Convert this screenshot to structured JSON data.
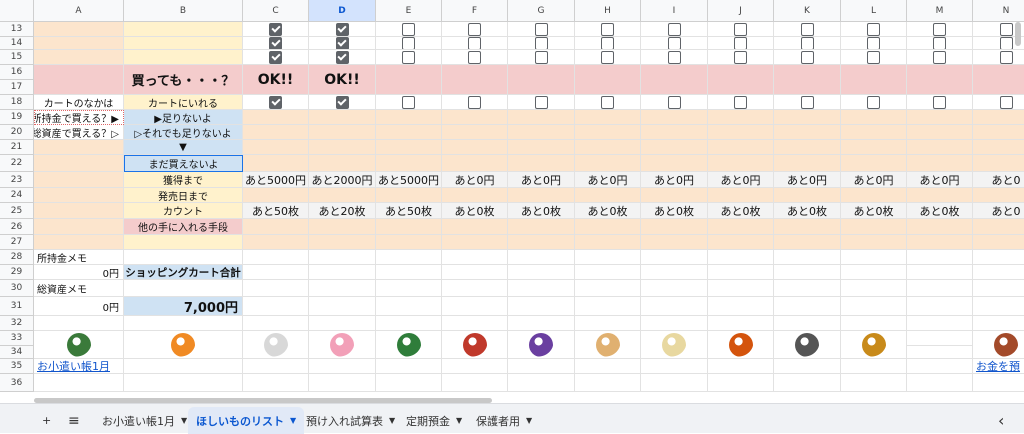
{
  "columns": [
    "A",
    "B",
    "C",
    "D",
    "E",
    "F",
    "G",
    "H",
    "I",
    "J",
    "K",
    "L",
    "M",
    "N"
  ],
  "selected_column": "D",
  "row_numbers": [
    "13",
    "14",
    "15",
    "16",
    "17",
    "18",
    "19",
    "20",
    "21",
    "22",
    "23",
    "24",
    "25",
    "26",
    "27",
    "28",
    "29",
    "30",
    "31",
    "32",
    "33",
    "34",
    "35",
    "36"
  ],
  "table": {
    "row16_title": "買っても・・・？",
    "ok_c": "OK!!",
    "ok_d": "OK!!",
    "cart_label": "カートのなかは",
    "cart_action": "カートにいれる",
    "funds_question": "所持金で買える？▶",
    "funds_answer": "▶足りないよ",
    "assets_question": "総資産で買える？▷",
    "assets_answer": "▷それでも足りないよ",
    "arrow": "▼",
    "still_cannot": "まだ買えないよ",
    "until_obtain": "獲得まで",
    "until_release": "発売日まで",
    "count": "カウント",
    "other_means": "他の手に入れる手段",
    "remaining_amounts": [
      "あと5000円",
      "あと2000円",
      "あと5000円",
      "あと0円",
      "あと0円",
      "あと0円",
      "あと0円",
      "あと0円",
      "あと0円",
      "あと0円",
      "あと0円",
      "あと0"
    ],
    "remaining_counts": [
      "あと50枚",
      "あと20枚",
      "あと50枚",
      "あと0枚",
      "あと0枚",
      "あと0枚",
      "あと0枚",
      "あと0枚",
      "あと0枚",
      "あと0枚",
      "あと0枚",
      "あと0"
    ],
    "checks_row13": [
      true,
      true,
      false,
      false,
      false,
      false,
      false,
      false,
      false,
      false,
      false,
      false
    ],
    "checks_row14": [
      true,
      true,
      false,
      false,
      false,
      false,
      false,
      false,
      false,
      false,
      false,
      false
    ],
    "checks_row15": [
      true,
      true,
      false,
      false,
      false,
      false,
      false,
      false,
      false,
      false,
      false,
      false
    ],
    "checks_row18": [
      true,
      true,
      false,
      false,
      false,
      false,
      false,
      false,
      false,
      false,
      false,
      false
    ]
  },
  "memo": {
    "funds_memo": "所持金メモ",
    "funds_value": "0円",
    "cart_total_label": "ショッピングカート合計",
    "assets_memo": "総資産メモ",
    "assets_value": "0円",
    "cart_total_value": "7,000円"
  },
  "links": {
    "allowance": "お小遣い帳1月",
    "money_cut": "お金を預"
  },
  "figures": {
    "icon_names": [
      "figure-usopp-icon",
      "figure-nami-icon",
      "figure-brook-icon",
      "figure-chopper-icon",
      "figure-zoro-icon",
      "figure-franky-icon",
      "figure-robin-icon",
      "figure-sanji-icon",
      "figure-law-icon",
      "figure-ace-icon",
      "figure-kid-icon",
      "figure-jinbe-icon",
      "figure-luffy-icon"
    ],
    "colors": [
      "#3a7a3a",
      "#f08a24",
      "#d8d8d8",
      "#f2a0b8",
      "#2f7d3a",
      "#c0392b",
      "#6a3fa0",
      "#e0b070",
      "#e8d8a0",
      "#d4540d",
      "#555555",
      "#c88a1a",
      "#a34a2a"
    ]
  },
  "sheet_tabs": {
    "add_icon": "+",
    "menu_icon": "≡",
    "tabs": [
      "お小遣い帳1月",
      "ほしいものリスト",
      "預け入れ試算表",
      "定期預金",
      "保護者用"
    ],
    "active_tab": "ほしいものリスト",
    "scroll_icon": "‹"
  },
  "palette": {
    "orange": "#fce5cd",
    "yellow": "#fff2cc",
    "pink": "#f4cccc",
    "blue": "#cfe2f3",
    "grey_row": "#f3f3f3",
    "grid": "#e2e2e2",
    "accent": "#0b57d0"
  }
}
